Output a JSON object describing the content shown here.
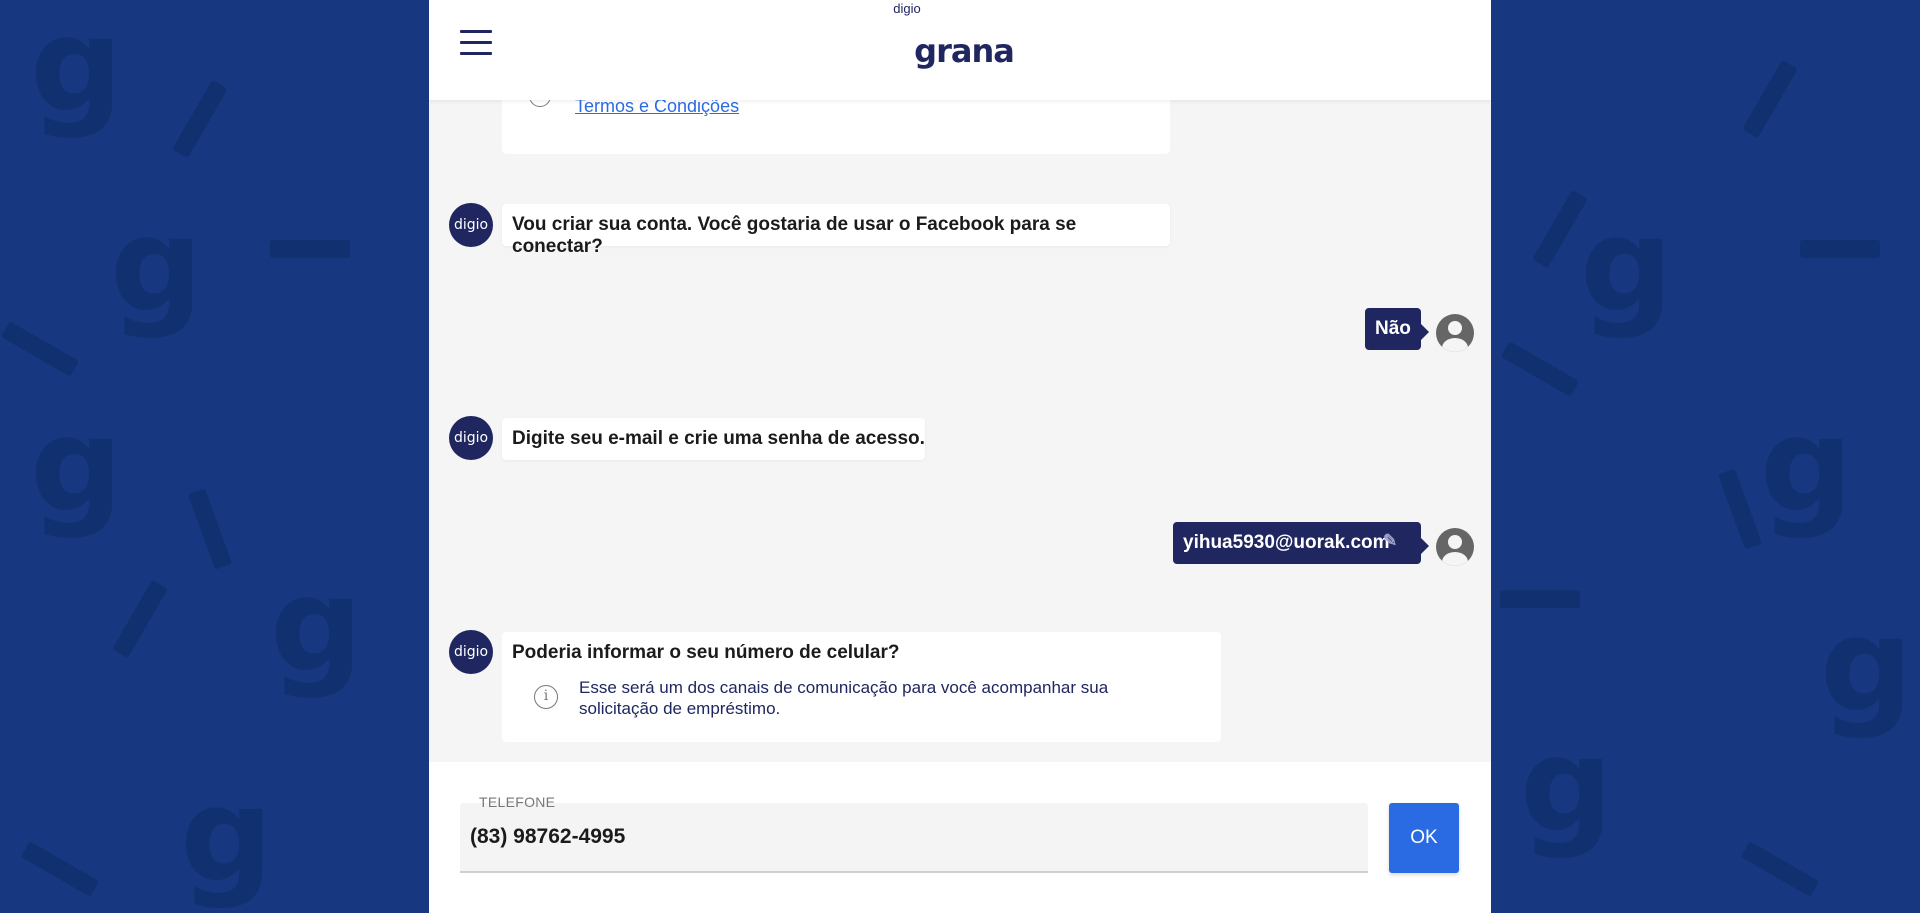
{
  "header": {
    "logo_small": "digio",
    "logo_big": "grana",
    "menu_icon": "hamburger-menu-icon"
  },
  "chat": {
    "terms_link": "Termos e Condições",
    "bot_avatar_label": "digio",
    "messages": {
      "facebook_question": "Vou criar sua conta. Você gostaria de usar o Facebook para se conectar?",
      "user_no": "Não",
      "email_prompt": "Digite seu e-mail e crie uma senha de acesso.",
      "user_email": "yihua5930@uorak.com",
      "phone_question": "Poderia informar o seu número de celular?",
      "phone_note": "Esse será um dos canais de comunicação para você acompanhar sua solicitação de empréstimo."
    },
    "info_glyph": "i"
  },
  "footer": {
    "phone_label": "TELEFONE",
    "phone_value": "(83) 98762-4995",
    "ok_label": "OK"
  },
  "colors": {
    "background": "#173880",
    "brand_navy": "#1f2660",
    "accent_blue": "#2a6be3",
    "chat_bg": "#f5f5f5"
  }
}
